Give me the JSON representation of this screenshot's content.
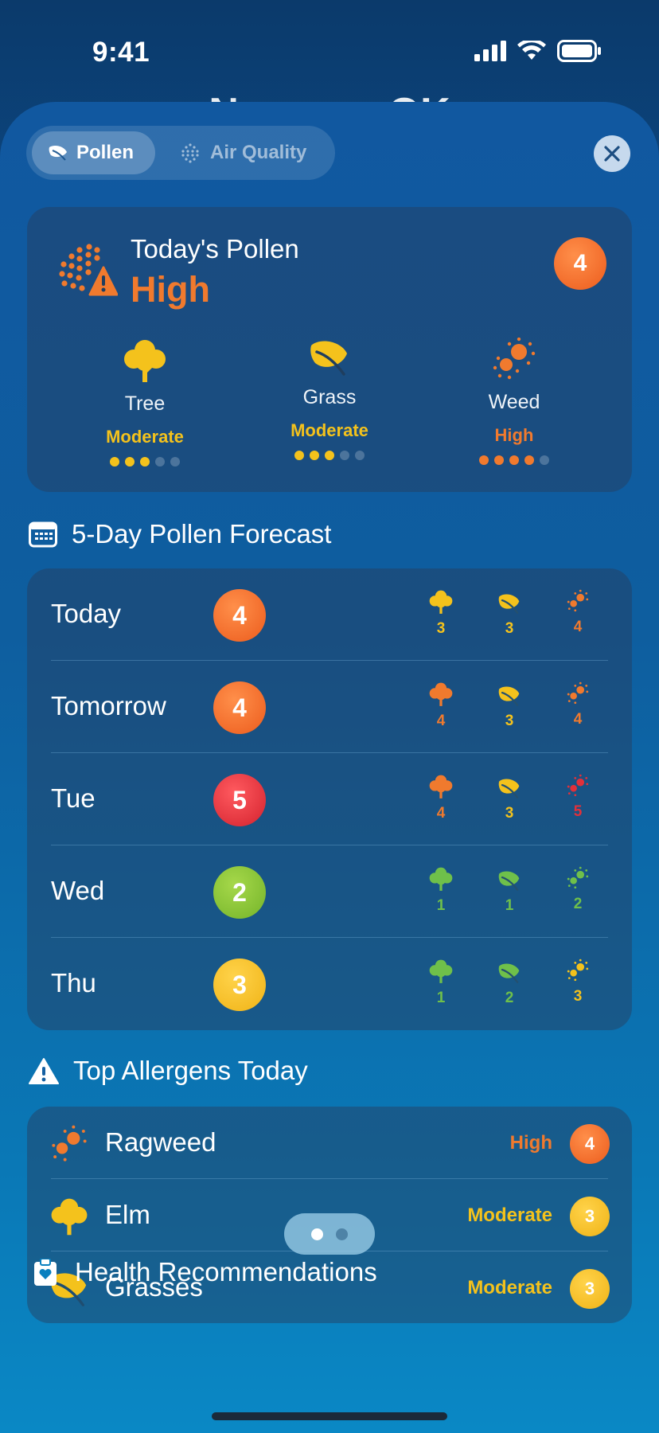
{
  "status": {
    "time": "9:41"
  },
  "background_title": "Norman, OK",
  "tabs": {
    "pollen": "Pollen",
    "air_quality": "Air Quality"
  },
  "today": {
    "title": "Today's Pollen",
    "level": "High",
    "index": "4",
    "types": [
      {
        "name": "Tree",
        "level": "Moderate",
        "color": "#f4c21c",
        "filled": 3
      },
      {
        "name": "Grass",
        "level": "Moderate",
        "color": "#f4c21c",
        "filled": 3
      },
      {
        "name": "Weed",
        "level": "High",
        "color": "#f07a2e",
        "filled": 4
      }
    ]
  },
  "forecast": {
    "title": "5-Day Pollen Forecast",
    "days": [
      {
        "day": "Today",
        "index": "4",
        "color": "orange",
        "tree": "3",
        "grass": "3",
        "weed": "4"
      },
      {
        "day": "Tomorrow",
        "index": "4",
        "color": "orange",
        "tree": "4",
        "grass": "3",
        "weed": "4"
      },
      {
        "day": "Tue",
        "index": "5",
        "color": "red",
        "tree": "4",
        "grass": "3",
        "weed": "5"
      },
      {
        "day": "Wed",
        "index": "2",
        "color": "green",
        "tree": "1",
        "grass": "1",
        "weed": "2"
      },
      {
        "day": "Thu",
        "index": "3",
        "color": "yellow",
        "tree": "1",
        "grass": "2",
        "weed": "3"
      }
    ]
  },
  "allergens": {
    "title": "Top Allergens Today",
    "items": [
      {
        "name": "Ragweed",
        "level": "High",
        "index": "4",
        "icon": "weed-icon"
      },
      {
        "name": "Elm",
        "level": "Moderate",
        "index": "3",
        "icon": "tree-icon"
      },
      {
        "name": "Grasses",
        "level": "Moderate",
        "index": "3",
        "icon": "grass-icon"
      }
    ]
  },
  "health": {
    "title": "Health Recommendations"
  },
  "colors": {
    "orange": "#f07a2e",
    "yellow": "#f4c21c",
    "green": "#6fc04a",
    "red": "#e2303a"
  }
}
